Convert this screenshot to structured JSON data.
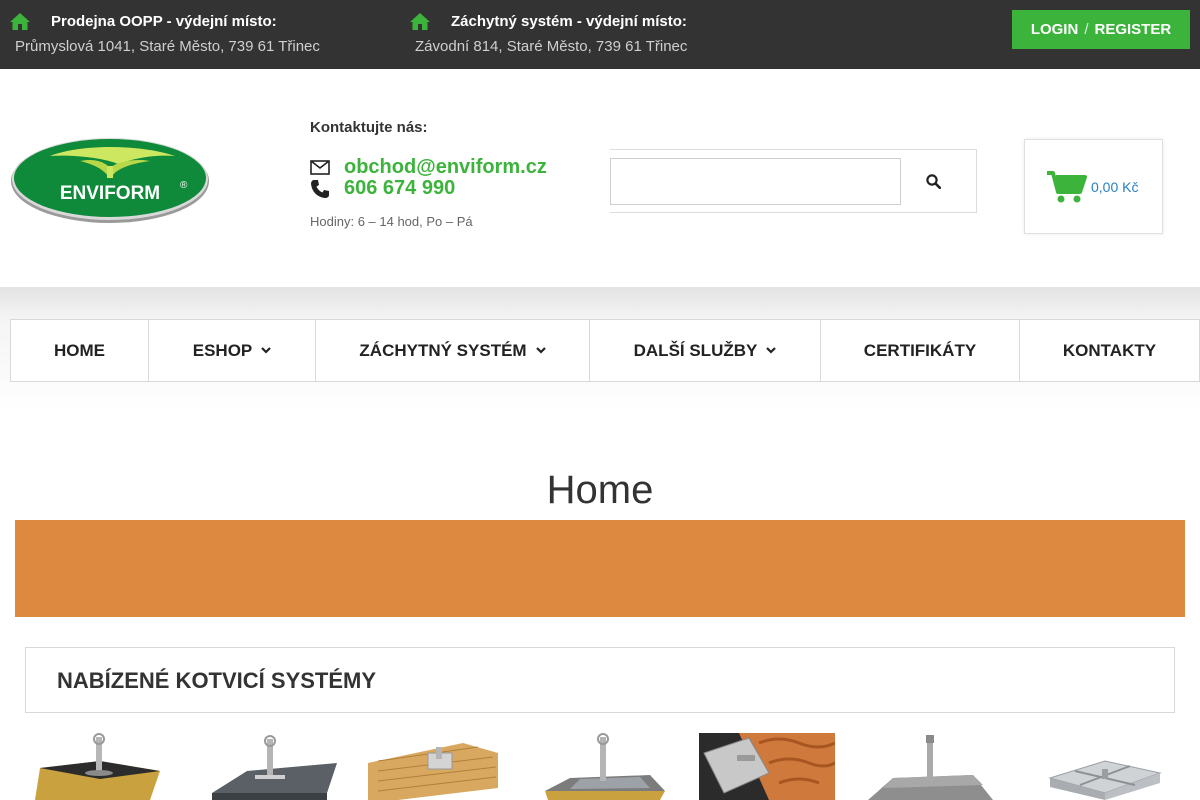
{
  "topbar": {
    "locations": [
      {
        "title": "Prodejna OOPP - výdejní místo:",
        "address": "Průmyslová 1041, Staré Město, 739 61 Třinec",
        "icon": "home-icon"
      },
      {
        "title": "Záchytný systém - výdejní místo:",
        "address": "Závodní 814, Staré Město, 739 61 Třinec",
        "icon": "home-icon"
      }
    ],
    "login_label": "LOGIN",
    "separator": "/",
    "register_label": "REGISTER"
  },
  "brand": {
    "logo_text": "ENVIFORM",
    "logo_mark": "®"
  },
  "contact": {
    "title": "Kontaktujte nás:",
    "email": "obchod@enviform.cz",
    "phone": "606 674 990",
    "hours": "Hodiny: 6 – 14 hod, Po – Pá"
  },
  "search": {
    "value": "",
    "placeholder": "",
    "icon": "search-icon"
  },
  "cart": {
    "total": "0,00 Kč",
    "icon": "cart-icon"
  },
  "nav": [
    {
      "label": "HOME",
      "dropdown": false
    },
    {
      "label": "ESHOP",
      "dropdown": true
    },
    {
      "label": "ZÁCHYTNÝ SYSTÉM",
      "dropdown": true
    },
    {
      "label": "DALŠÍ SLUŽBY",
      "dropdown": true
    },
    {
      "label": "CERTIFIKÁTY",
      "dropdown": false
    },
    {
      "label": "KONTAKTY",
      "dropdown": false
    }
  ],
  "page": {
    "title": "Home"
  },
  "section": {
    "title": "NABÍZENÉ KOTVICÍ SYSTÉMY"
  },
  "colors": {
    "accent": "#3cb43c",
    "topbar": "#333333",
    "banner": "#dd8a40",
    "link": "#2a7fc1"
  }
}
